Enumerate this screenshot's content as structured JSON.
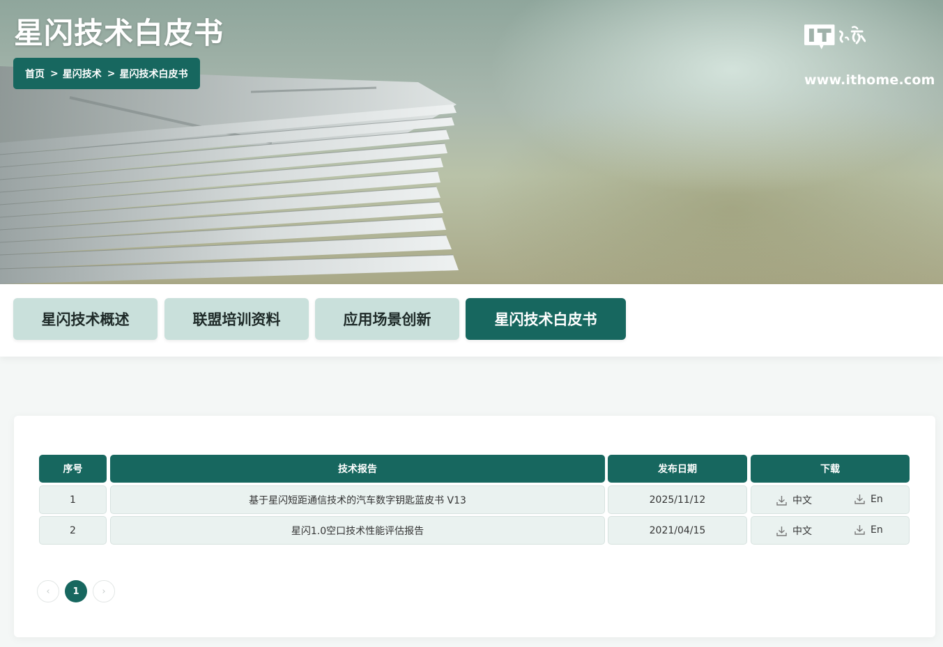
{
  "hero": {
    "title": "星闪技术白皮书",
    "breadcrumb": [
      "首页",
      "星闪技术",
      "星闪技术白皮书"
    ],
    "breadcrumb_sep": ">",
    "logo_url": "www.ithome.com",
    "logo_text": "IT之家"
  },
  "tabs": [
    {
      "label": "星闪技术概述",
      "active": false
    },
    {
      "label": "联盟培训资料",
      "active": false
    },
    {
      "label": "应用场景创新",
      "active": false
    },
    {
      "label": "星闪技术白皮书",
      "active": true
    }
  ],
  "table": {
    "headers": [
      "序号",
      "技术报告",
      "发布日期",
      "下载"
    ],
    "rows": [
      {
        "index": "1",
        "title": "基于星闪短距通信技术的汽车数字钥匙蓝皮书 V13",
        "date": "2025/11/12",
        "dl_zh": "中文",
        "dl_en": "En"
      },
      {
        "index": "2",
        "title": "星闪1.0空口技术性能评估报告",
        "date": "2021/04/15",
        "dl_zh": "中文",
        "dl_en": "En"
      }
    ]
  },
  "pagination": {
    "prev": "‹",
    "current": "1",
    "next": "›"
  },
  "colors": {
    "primary": "#17675f",
    "tab_inactive": "#c9e0db",
    "cell_bg": "#eaf2f0"
  }
}
